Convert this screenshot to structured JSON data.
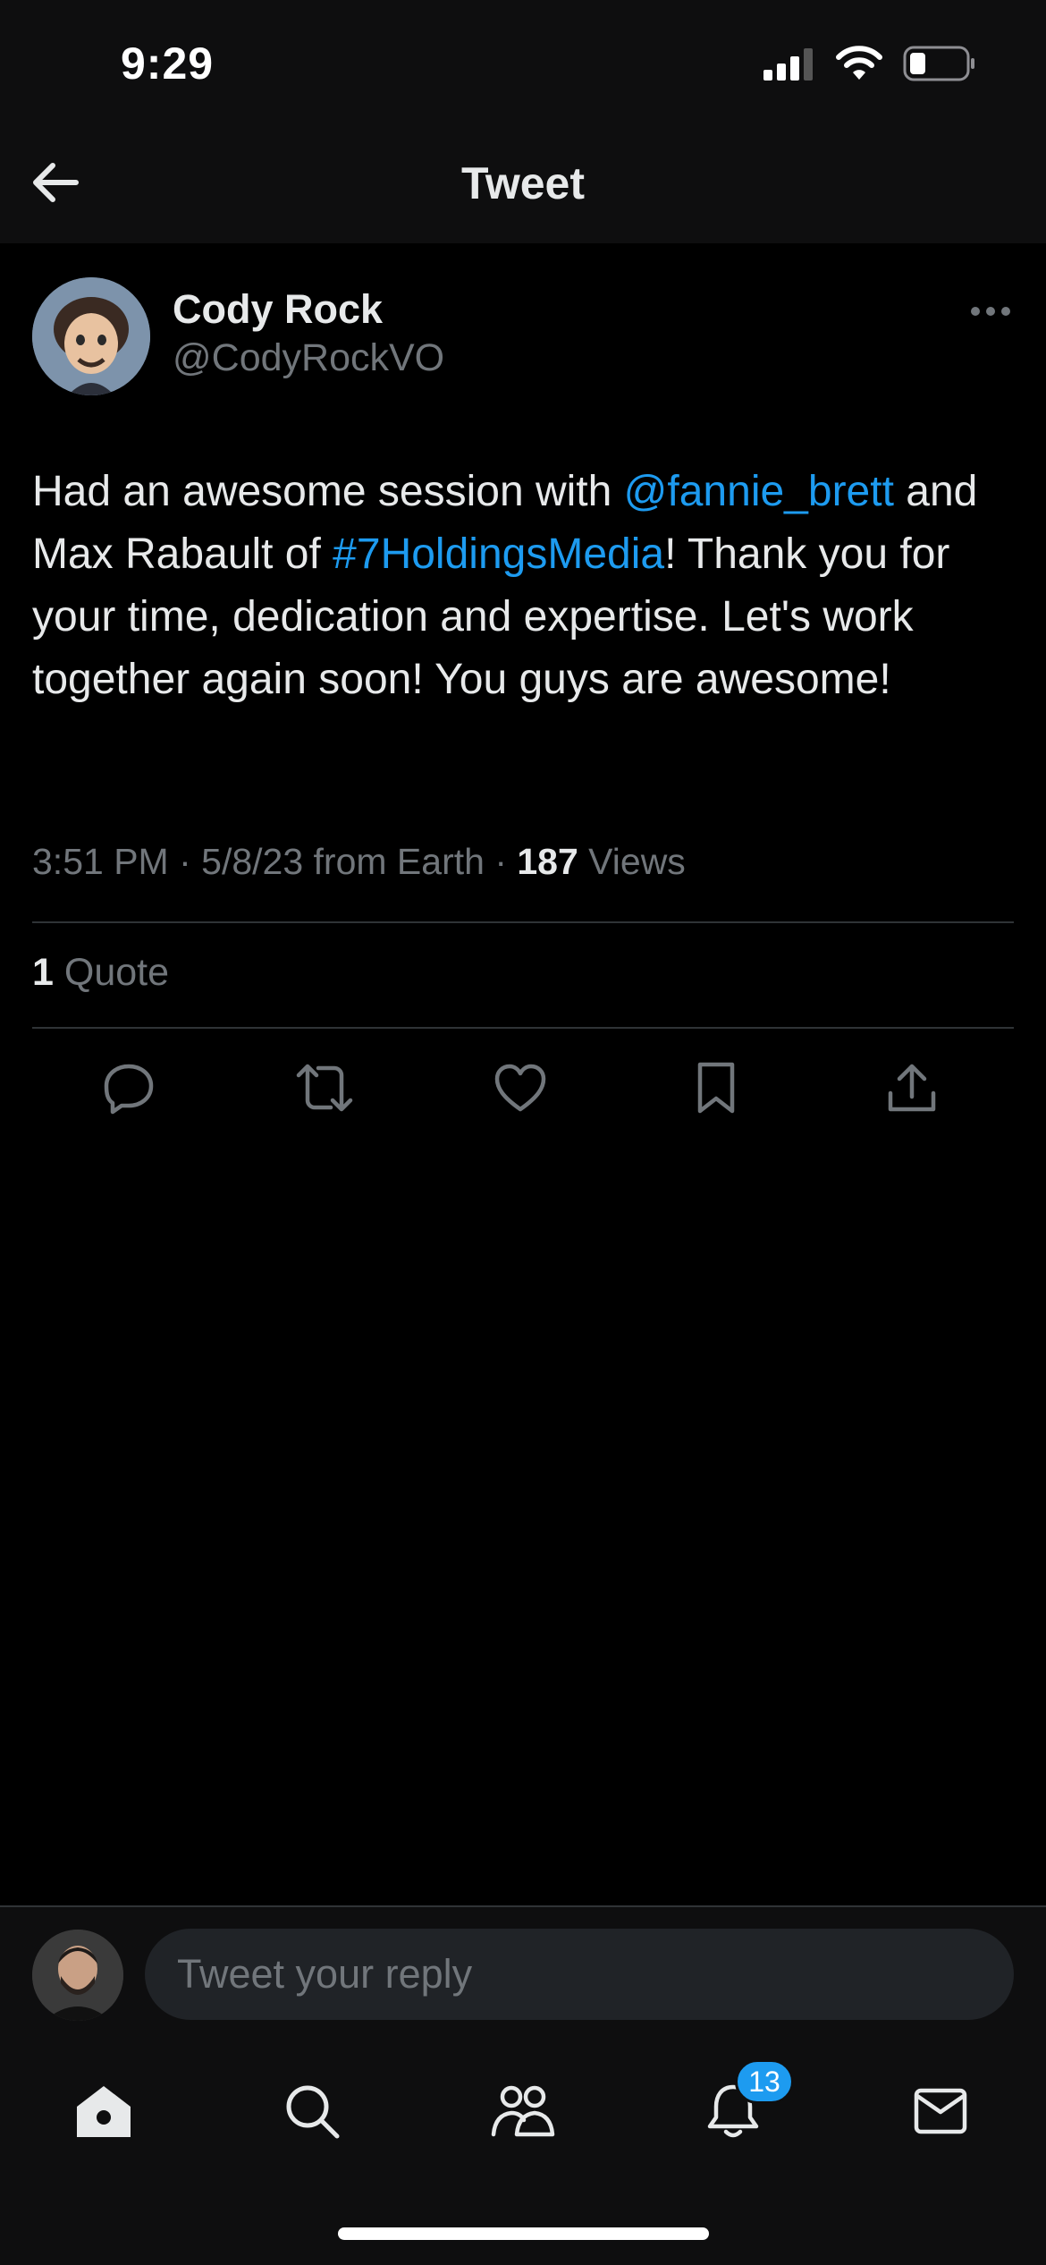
{
  "status_bar": {
    "time": "9:29"
  },
  "nav": {
    "title": "Tweet"
  },
  "tweet": {
    "author_name": "Cody Rock",
    "author_handle": "@CodyRockVO",
    "text_parts": {
      "p1": "Had an awesome session with ",
      "mention": "@fannie_brett",
      "p2": " and Max Rabault of ",
      "hashtag": "#7HoldingsMedia",
      "p3": "! Thank you for your time, dedication and expertise. Let's work together again soon! You guys are awesome!"
    },
    "meta": {
      "time": "3:51 PM",
      "sep1": " · ",
      "date_source": "5/8/23 from Earth",
      "sep2": " · ",
      "views_count": "187",
      "views_label": " Views"
    },
    "quotes": {
      "count": "1",
      "label": " Quote"
    }
  },
  "actions": {
    "icons": [
      "reply-icon",
      "retweet-icon",
      "like-icon",
      "bookmark-icon",
      "share-icon"
    ]
  },
  "reply": {
    "placeholder": "Tweet your reply"
  },
  "tab_bar": {
    "notifications_badge": "13",
    "icons": [
      "home-icon",
      "search-icon",
      "communities-icon",
      "notifications-icon",
      "messages-icon"
    ]
  },
  "colors": {
    "accent": "#1d9bf0",
    "background": "#000000",
    "bar_background": "#0e0e0f",
    "text_primary": "#e7e9ea",
    "text_secondary": "#71767b",
    "divider": "#2f3336"
  }
}
